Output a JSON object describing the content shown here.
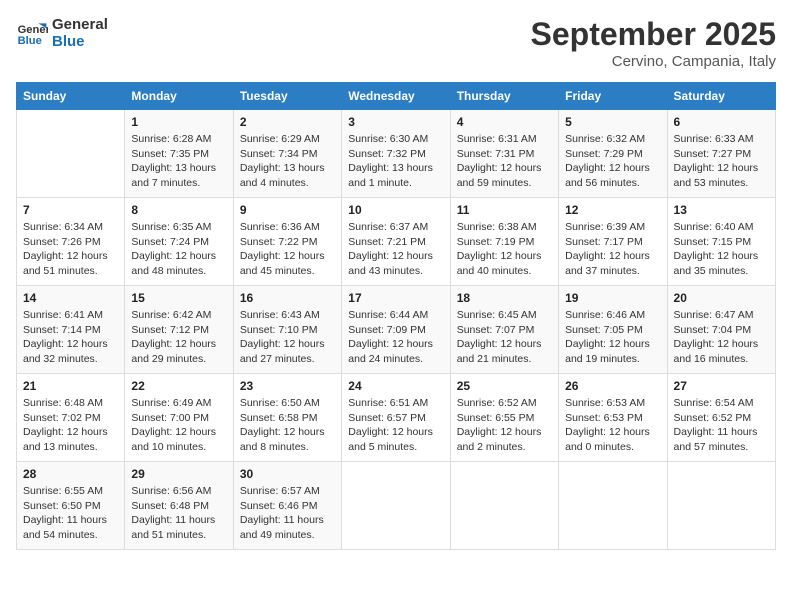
{
  "header": {
    "logo_line1": "General",
    "logo_line2": "Blue",
    "month": "September 2025",
    "location": "Cervino, Campania, Italy"
  },
  "weekdays": [
    "Sunday",
    "Monday",
    "Tuesday",
    "Wednesday",
    "Thursday",
    "Friday",
    "Saturday"
  ],
  "weeks": [
    [
      {
        "day": "",
        "info": ""
      },
      {
        "day": "1",
        "info": "Sunrise: 6:28 AM\nSunset: 7:35 PM\nDaylight: 13 hours\nand 7 minutes."
      },
      {
        "day": "2",
        "info": "Sunrise: 6:29 AM\nSunset: 7:34 PM\nDaylight: 13 hours\nand 4 minutes."
      },
      {
        "day": "3",
        "info": "Sunrise: 6:30 AM\nSunset: 7:32 PM\nDaylight: 13 hours\nand 1 minute."
      },
      {
        "day": "4",
        "info": "Sunrise: 6:31 AM\nSunset: 7:31 PM\nDaylight: 12 hours\nand 59 minutes."
      },
      {
        "day": "5",
        "info": "Sunrise: 6:32 AM\nSunset: 7:29 PM\nDaylight: 12 hours\nand 56 minutes."
      },
      {
        "day": "6",
        "info": "Sunrise: 6:33 AM\nSunset: 7:27 PM\nDaylight: 12 hours\nand 53 minutes."
      }
    ],
    [
      {
        "day": "7",
        "info": "Sunrise: 6:34 AM\nSunset: 7:26 PM\nDaylight: 12 hours\nand 51 minutes."
      },
      {
        "day": "8",
        "info": "Sunrise: 6:35 AM\nSunset: 7:24 PM\nDaylight: 12 hours\nand 48 minutes."
      },
      {
        "day": "9",
        "info": "Sunrise: 6:36 AM\nSunset: 7:22 PM\nDaylight: 12 hours\nand 45 minutes."
      },
      {
        "day": "10",
        "info": "Sunrise: 6:37 AM\nSunset: 7:21 PM\nDaylight: 12 hours\nand 43 minutes."
      },
      {
        "day": "11",
        "info": "Sunrise: 6:38 AM\nSunset: 7:19 PM\nDaylight: 12 hours\nand 40 minutes."
      },
      {
        "day": "12",
        "info": "Sunrise: 6:39 AM\nSunset: 7:17 PM\nDaylight: 12 hours\nand 37 minutes."
      },
      {
        "day": "13",
        "info": "Sunrise: 6:40 AM\nSunset: 7:15 PM\nDaylight: 12 hours\nand 35 minutes."
      }
    ],
    [
      {
        "day": "14",
        "info": "Sunrise: 6:41 AM\nSunset: 7:14 PM\nDaylight: 12 hours\nand 32 minutes."
      },
      {
        "day": "15",
        "info": "Sunrise: 6:42 AM\nSunset: 7:12 PM\nDaylight: 12 hours\nand 29 minutes."
      },
      {
        "day": "16",
        "info": "Sunrise: 6:43 AM\nSunset: 7:10 PM\nDaylight: 12 hours\nand 27 minutes."
      },
      {
        "day": "17",
        "info": "Sunrise: 6:44 AM\nSunset: 7:09 PM\nDaylight: 12 hours\nand 24 minutes."
      },
      {
        "day": "18",
        "info": "Sunrise: 6:45 AM\nSunset: 7:07 PM\nDaylight: 12 hours\nand 21 minutes."
      },
      {
        "day": "19",
        "info": "Sunrise: 6:46 AM\nSunset: 7:05 PM\nDaylight: 12 hours\nand 19 minutes."
      },
      {
        "day": "20",
        "info": "Sunrise: 6:47 AM\nSunset: 7:04 PM\nDaylight: 12 hours\nand 16 minutes."
      }
    ],
    [
      {
        "day": "21",
        "info": "Sunrise: 6:48 AM\nSunset: 7:02 PM\nDaylight: 12 hours\nand 13 minutes."
      },
      {
        "day": "22",
        "info": "Sunrise: 6:49 AM\nSunset: 7:00 PM\nDaylight: 12 hours\nand 10 minutes."
      },
      {
        "day": "23",
        "info": "Sunrise: 6:50 AM\nSunset: 6:58 PM\nDaylight: 12 hours\nand 8 minutes."
      },
      {
        "day": "24",
        "info": "Sunrise: 6:51 AM\nSunset: 6:57 PM\nDaylight: 12 hours\nand 5 minutes."
      },
      {
        "day": "25",
        "info": "Sunrise: 6:52 AM\nSunset: 6:55 PM\nDaylight: 12 hours\nand 2 minutes."
      },
      {
        "day": "26",
        "info": "Sunrise: 6:53 AM\nSunset: 6:53 PM\nDaylight: 12 hours\nand 0 minutes."
      },
      {
        "day": "27",
        "info": "Sunrise: 6:54 AM\nSunset: 6:52 PM\nDaylight: 11 hours\nand 57 minutes."
      }
    ],
    [
      {
        "day": "28",
        "info": "Sunrise: 6:55 AM\nSunset: 6:50 PM\nDaylight: 11 hours\nand 54 minutes."
      },
      {
        "day": "29",
        "info": "Sunrise: 6:56 AM\nSunset: 6:48 PM\nDaylight: 11 hours\nand 51 minutes."
      },
      {
        "day": "30",
        "info": "Sunrise: 6:57 AM\nSunset: 6:46 PM\nDaylight: 11 hours\nand 49 minutes."
      },
      {
        "day": "",
        "info": ""
      },
      {
        "day": "",
        "info": ""
      },
      {
        "day": "",
        "info": ""
      },
      {
        "day": "",
        "info": ""
      }
    ]
  ]
}
